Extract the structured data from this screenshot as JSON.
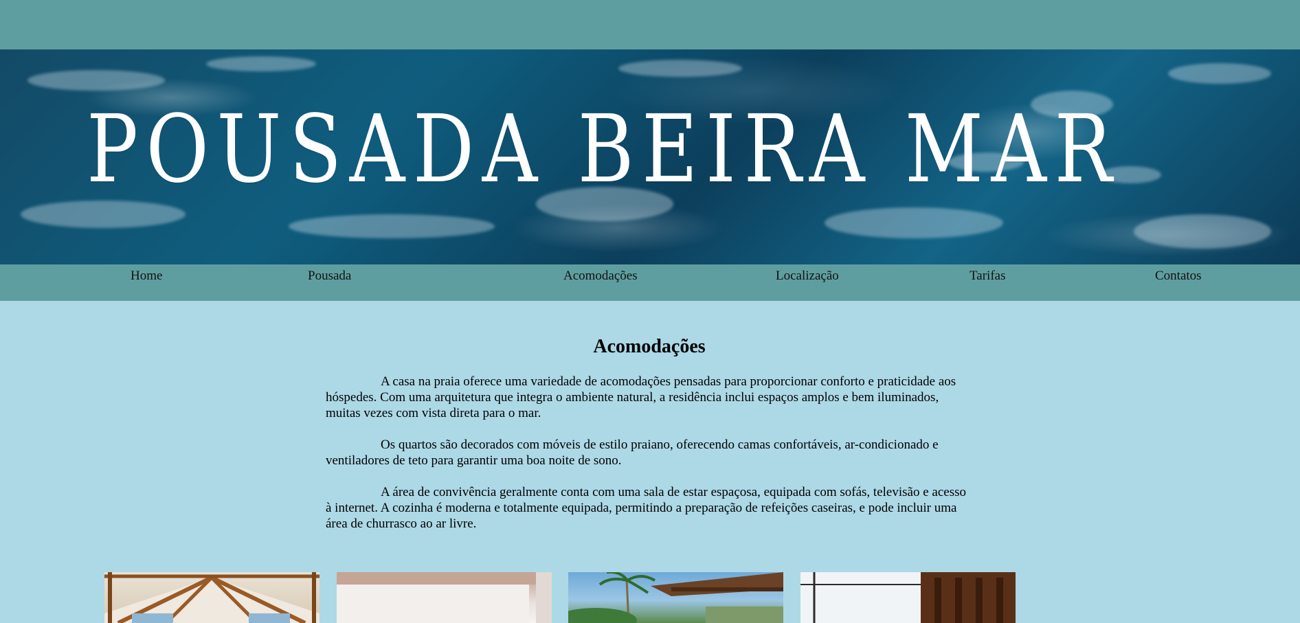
{
  "banner": {
    "title": "POUSADA BEIRA MAR"
  },
  "nav": {
    "items": [
      {
        "label": "Home"
      },
      {
        "label": "Pousada"
      },
      {
        "label": "Acomodações"
      },
      {
        "label": "Localização"
      },
      {
        "label": "Tarifas"
      },
      {
        "label": "Contatos"
      }
    ]
  },
  "main": {
    "heading": "Acomodações",
    "paragraphs": [
      "A casa na praia oferece uma variedade de acomodações pensadas para proporcionar conforto e praticidade aos hóspedes. Com uma arquitetura que integra o ambiente natural, a residência inclui espaços amplos e bem iluminados, muitas vezes com vista direta para o mar.",
      "Os quartos são decorados com móveis de estilo praiano, oferecendo camas confortáveis, ar-condicionado e ventiladores de teto para garantir uma boa noite de sono.",
      "A área de convivência geralmente conta com uma sala de estar espaçosa, equipada com sofás, televisão e acesso à internet. A cozinha é moderna e totalmente equipada, permitindo a preparação de refeições caseiras, e pode incluir uma área de churrasco ao ar livre."
    ]
  },
  "colors": {
    "page_background": "#add8e6",
    "band": "#5f9ea0",
    "banner_sea": "#0f5d7e"
  }
}
